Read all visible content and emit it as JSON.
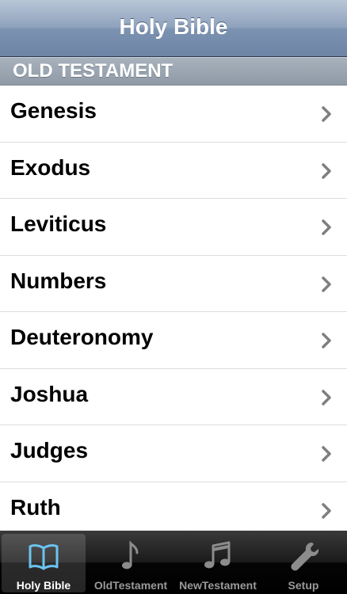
{
  "navbar": {
    "title": "Holy Bible"
  },
  "section": {
    "header": "OLD TESTAMENT"
  },
  "books": [
    {
      "label": "Genesis"
    },
    {
      "label": "Exodus"
    },
    {
      "label": "Leviticus"
    },
    {
      "label": "Numbers"
    },
    {
      "label": "Deuteronomy"
    },
    {
      "label": "Joshua"
    },
    {
      "label": "Judges"
    },
    {
      "label": "Ruth"
    }
  ],
  "tabs": [
    {
      "label": "Holy Bible",
      "icon": "book-icon",
      "active": true
    },
    {
      "label": "OldTestament",
      "icon": "music-note-icon",
      "active": false
    },
    {
      "label": "NewTestament",
      "icon": "double-music-note-icon",
      "active": false
    },
    {
      "label": "Setup",
      "icon": "wrench-icon",
      "active": false
    }
  ],
  "colors": {
    "navbar": "#7c92b1",
    "section_header": "#98a3ae",
    "active_tab_icon": "#6cc3f0"
  }
}
